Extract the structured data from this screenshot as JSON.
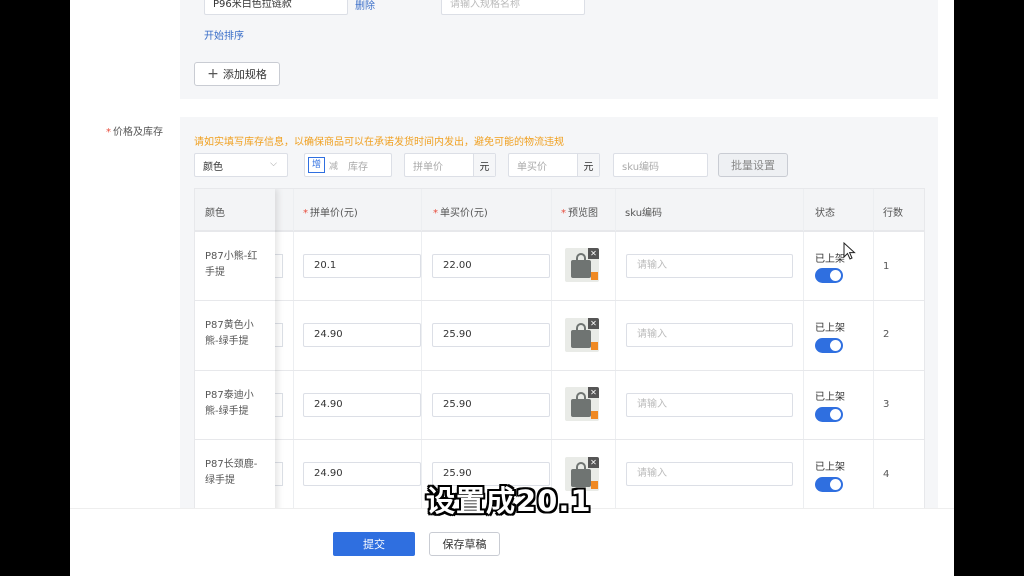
{
  "spec": {
    "name_value": "P96米白色拉链款",
    "delete_label": "删除",
    "name_placeholder": "请输入规格名称",
    "sort_label": "开始排序",
    "add_spec_label": "添加规格"
  },
  "price_section": {
    "label": "价格及库存",
    "warning": "请如实填写库存信息，以确保商品可以在承诺发货时间内发出，避免可能的物流违规",
    "color_select": "颜色",
    "stock_add": "增",
    "stock_sub": "减",
    "stock_placeholder": "库存",
    "group_price_placeholder": "拼单价",
    "single_price_placeholder": "单买价",
    "unit": "元",
    "sku_placeholder": "sku编码",
    "batch_label": "批量设置"
  },
  "table": {
    "headers": {
      "color": "颜色",
      "group_price": "拼单价(元)",
      "single_price": "单买价(元)",
      "preview": "预览图",
      "sku": "sku编码",
      "status": "状态",
      "rownum": "行数"
    },
    "sku_placeholder": "请输入",
    "rows": [
      {
        "color": "P87小熊-红手提",
        "group_price": "20.1",
        "single_price": "22.00",
        "status": "已上架",
        "on": true,
        "num": "1"
      },
      {
        "color": "P87黄色小熊-绿手提",
        "group_price": "24.90",
        "single_price": "25.90",
        "status": "已上架",
        "on": true,
        "num": "2"
      },
      {
        "color": "P87泰迪小熊-绿手提",
        "group_price": "24.90",
        "single_price": "25.90",
        "status": "已上架",
        "on": true,
        "num": "3"
      },
      {
        "color": "P87长颈鹿-绿手提",
        "group_price": "24.90",
        "single_price": "25.90",
        "status": "已上架",
        "on": true,
        "num": "4"
      }
    ]
  },
  "footer": {
    "submit_label": "提交",
    "draft_label": "保存草稿"
  },
  "overlay": {
    "subtitle": "设置成20.1"
  },
  "colors": {
    "primary": "#2f6fe0",
    "warning": "#f0a020",
    "required": "#e74c3c"
  }
}
